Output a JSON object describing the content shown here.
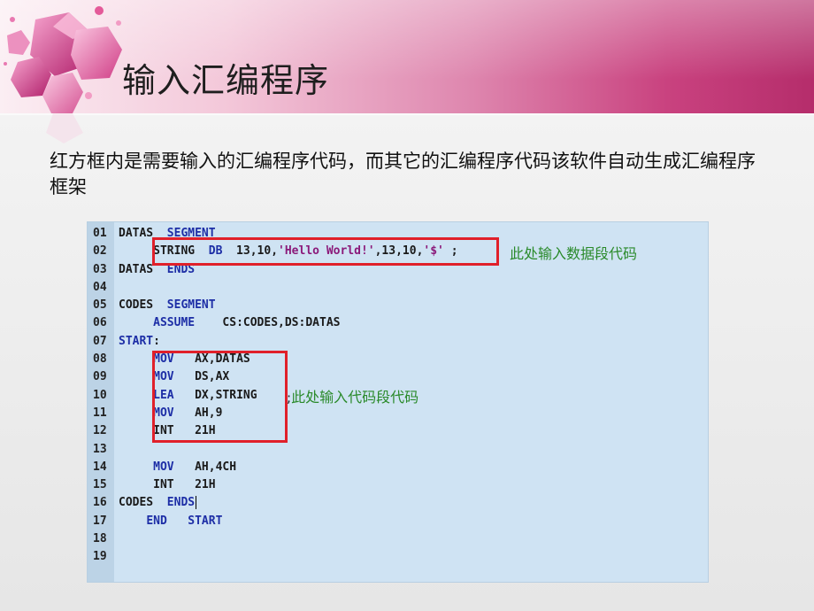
{
  "slide": {
    "title": "输入汇编程序",
    "description": "红方框内是需要输入的汇编程序代码，而其它的汇编程序代码该软件自动生成汇编程序框架"
  },
  "editor": {
    "lines": [
      {
        "num": "01",
        "segments": [
          {
            "t": "DATAS  ",
            "c": ""
          },
          {
            "t": "SEGMENT",
            "c": "kw"
          }
        ]
      },
      {
        "num": "02",
        "segments": [
          {
            "t": "     STRING  ",
            "c": ""
          },
          {
            "t": "DB",
            "c": "kw"
          },
          {
            "t": "  13,10,",
            "c": ""
          },
          {
            "t": "'Hello World!'",
            "c": "str"
          },
          {
            "t": ",13,10,",
            "c": ""
          },
          {
            "t": "'$'",
            "c": "str"
          },
          {
            "t": " ;",
            "c": ""
          }
        ]
      },
      {
        "num": "03",
        "segments": [
          {
            "t": "DATAS  ",
            "c": ""
          },
          {
            "t": "ENDS",
            "c": "kw"
          }
        ]
      },
      {
        "num": "04",
        "segments": []
      },
      {
        "num": "05",
        "segments": [
          {
            "t": "CODES  ",
            "c": ""
          },
          {
            "t": "SEGMENT",
            "c": "kw"
          }
        ]
      },
      {
        "num": "06",
        "segments": [
          {
            "t": "     ",
            "c": ""
          },
          {
            "t": "ASSUME",
            "c": "kw"
          },
          {
            "t": "    CS:CODES,DS:DATAS",
            "c": ""
          }
        ]
      },
      {
        "num": "07",
        "segments": [
          {
            "t": "START",
            "c": "kw"
          },
          {
            "t": ":",
            "c": ""
          }
        ]
      },
      {
        "num": "08",
        "segments": [
          {
            "t": "     ",
            "c": ""
          },
          {
            "t": "MOV",
            "c": "kw"
          },
          {
            "t": "   AX,DATAS",
            "c": ""
          }
        ]
      },
      {
        "num": "09",
        "segments": [
          {
            "t": "     ",
            "c": ""
          },
          {
            "t": "MOV",
            "c": "kw"
          },
          {
            "t": "   DS,AX",
            "c": ""
          }
        ]
      },
      {
        "num": "10",
        "segments": [
          {
            "t": "     ",
            "c": ""
          },
          {
            "t": "LEA",
            "c": "kw"
          },
          {
            "t": "   DX,STRING",
            "c": ""
          }
        ]
      },
      {
        "num": "11",
        "segments": [
          {
            "t": "     ",
            "c": ""
          },
          {
            "t": "MOV",
            "c": "kw"
          },
          {
            "t": "   AH,9",
            "c": ""
          }
        ]
      },
      {
        "num": "12",
        "segments": [
          {
            "t": "     INT   21H",
            "c": ""
          }
        ]
      },
      {
        "num": "13",
        "segments": []
      },
      {
        "num": "14",
        "segments": [
          {
            "t": "     ",
            "c": ""
          },
          {
            "t": "MOV",
            "c": "kw"
          },
          {
            "t": "   AH,4CH",
            "c": ""
          }
        ]
      },
      {
        "num": "15",
        "segments": [
          {
            "t": "     INT   21H",
            "c": ""
          }
        ]
      },
      {
        "num": "16",
        "segments": [
          {
            "t": "CODES  ",
            "c": ""
          },
          {
            "t": "ENDS",
            "c": "kw"
          }
        ],
        "caret": true
      },
      {
        "num": "17",
        "segments": [
          {
            "t": "    ",
            "c": ""
          },
          {
            "t": "END",
            "c": "kw"
          },
          {
            "t": "   ",
            "c": ""
          },
          {
            "t": "START",
            "c": "kw"
          }
        ]
      },
      {
        "num": "18",
        "segments": []
      },
      {
        "num": "19",
        "segments": []
      }
    ],
    "comment_data": "此处输入数据段代码",
    "comment_code": "此处输入代码段代码",
    "comment_code_prefix": ";"
  },
  "colors": {
    "accent": "#c9427f",
    "highlight_box": "#e0202a",
    "keyword": "#1d2ea6",
    "string": "#8b1a7a",
    "comment": "#2a8a2a",
    "editor_bg": "#cfe3f3"
  },
  "icons": [
    "pink-crystal-decoration"
  ]
}
